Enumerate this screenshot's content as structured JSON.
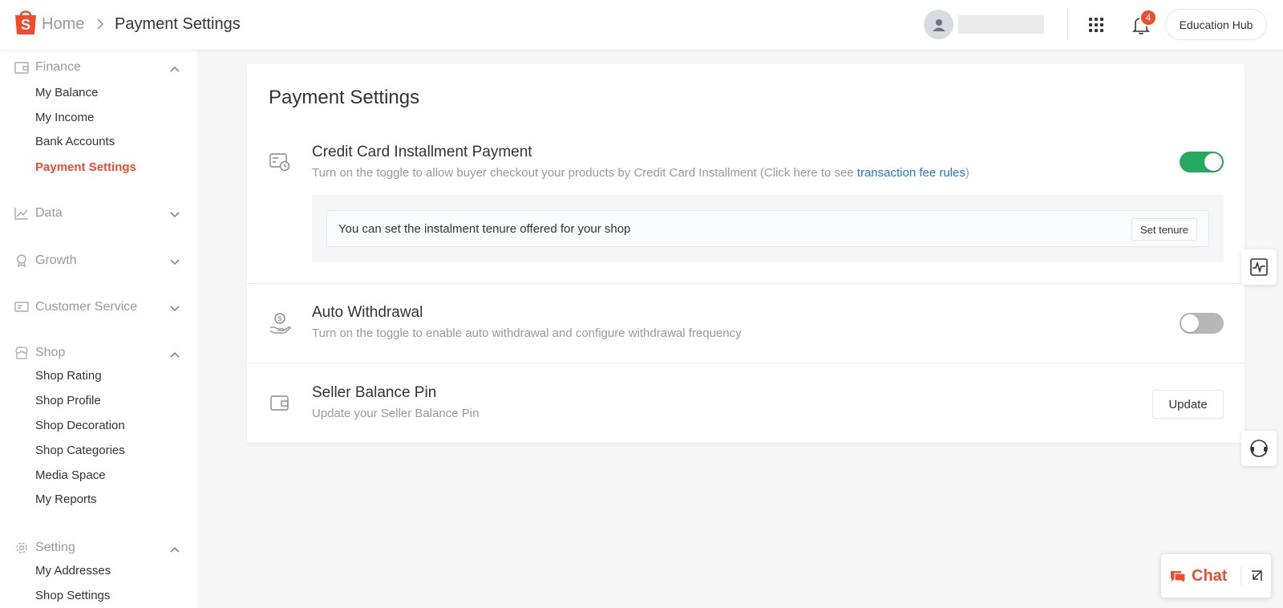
{
  "colors": {
    "brand": "#ee4d2d",
    "toggle_on": "#26aa5f",
    "toggle_off": "#b7b7b7",
    "link": "#2673dd"
  },
  "header": {
    "breadcrumb_home": "Home",
    "breadcrumb_current": "Payment Settings",
    "notification_count": "4",
    "education_hub_label": "Education Hub"
  },
  "sidebar": {
    "groups": {
      "finance": {
        "label": "Finance",
        "expanded": true,
        "icon": "wallet-icon"
      },
      "data": {
        "label": "Data",
        "expanded": false,
        "icon": "chart-line-icon"
      },
      "growth": {
        "label": "Growth",
        "expanded": false,
        "icon": "badge-icon"
      },
      "customer_service": {
        "label": "Customer Service",
        "expanded": false,
        "icon": "chat-box-icon"
      },
      "shop": {
        "label": "Shop",
        "expanded": true,
        "icon": "shop-icon"
      },
      "setting": {
        "label": "Setting",
        "expanded": true,
        "icon": "gear-icon"
      }
    },
    "finance_items": [
      "My Balance",
      "My Income",
      "Bank Accounts",
      "Payment Settings"
    ],
    "shop_items": [
      "Shop Rating",
      "Shop Profile",
      "Shop Decoration",
      "Shop Categories",
      "Media Space",
      "My Reports"
    ],
    "setting_items": [
      "My Addresses",
      "Shop Settings"
    ],
    "active_item": "Payment Settings"
  },
  "main": {
    "title": "Payment Settings",
    "credit_card": {
      "title": "Credit Card Installment Payment",
      "desc_prefix": "Turn on the toggle to allow buyer checkout your products by Credit Card Installment (Click here to see ",
      "desc_link": "transaction fee rules",
      "desc_suffix": ")",
      "enabled": true,
      "tenure_text": "You can set the instalment tenure offered for your shop",
      "tenure_button": "Set tenure"
    },
    "auto_withdrawal": {
      "title": "Auto Withdrawal",
      "desc": "Turn on the toggle to enable auto withdrawal and configure withdrawal frequency",
      "enabled": false
    },
    "seller_pin": {
      "title": "Seller Balance Pin",
      "desc": "Update your Seller Balance Pin",
      "button": "Update"
    }
  },
  "chat": {
    "label": "Chat"
  }
}
